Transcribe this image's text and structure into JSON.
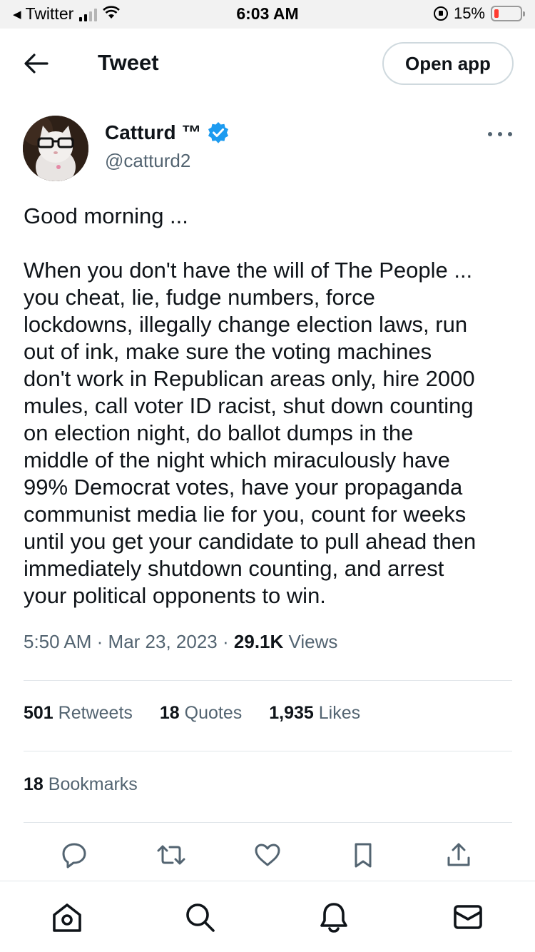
{
  "status_bar": {
    "back_app": "Twitter",
    "time": "6:03 AM",
    "battery": "15%",
    "signal_bars_filled": 2,
    "signal_bars_total": 4
  },
  "header": {
    "title": "Tweet",
    "open_app_label": "Open app"
  },
  "author": {
    "name": "Catturd ™",
    "handle": "@catturd2",
    "verified": true
  },
  "tweet": {
    "paragraphs": [
      [
        "Good morning ..."
      ],
      [
        "When you don't have the will of The People ...",
        "you cheat, lie, fudge numbers, force",
        "lockdowns, illegally change election laws, run",
        "out of ink, make sure the voting machines",
        "don't work in Republican areas only, hire 2000",
        "mules, call voter ID racist, shut down counting",
        "on election night, do ballot dumps in the",
        "middle of the night which miraculously have",
        "99% Democrat votes, have your propaganda",
        "communist media lie for you, count for weeks",
        "until you get your candidate to pull ahead then",
        "immediately shutdown counting, and arrest",
        "your political opponents to win."
      ]
    ],
    "time": "5:50 AM",
    "separator": "·",
    "date": "Mar 23, 2023",
    "views_count": "29.1K",
    "views_label": "Views"
  },
  "stats": {
    "retweets_count": "501",
    "retweets_label": "Retweets",
    "quotes_count": "18",
    "quotes_label": "Quotes",
    "likes_count": "1,935",
    "likes_label": "Likes",
    "bookmarks_count": "18",
    "bookmarks_label": "Bookmarks"
  },
  "actions": [
    "reply-icon",
    "retweet-icon",
    "like-icon",
    "bookmark-icon",
    "share-icon"
  ],
  "tabbar": [
    "home-icon",
    "search-icon",
    "notifications-icon",
    "messages-icon"
  ],
  "colors": {
    "text": "#0f1419",
    "secondary": "#536471",
    "verified": "#1d9bf0",
    "divider": "#e1e6ea",
    "battery_low": "#ff3b30"
  }
}
